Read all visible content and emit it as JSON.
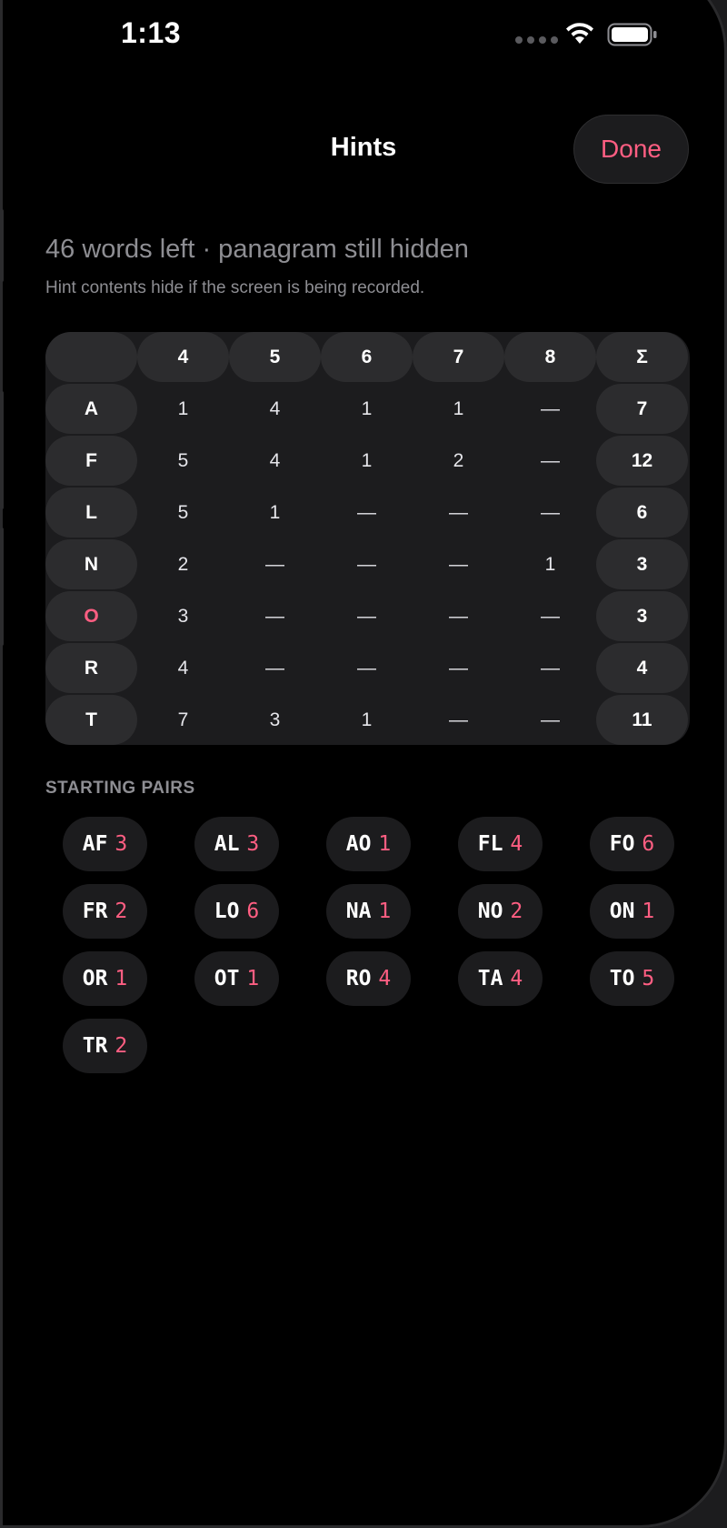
{
  "status_bar": {
    "time": "1:13"
  },
  "header": {
    "title": "Hints",
    "done_label": "Done"
  },
  "summary": "46 words left · panagram still hidden",
  "subnote": "Hint contents hide if the screen is being recorded.",
  "table": {
    "columns": [
      "4",
      "5",
      "6",
      "7",
      "8",
      "Σ"
    ],
    "rows": [
      {
        "letter": "A",
        "values": [
          "1",
          "4",
          "1",
          "1",
          "—"
        ],
        "total": "7"
      },
      {
        "letter": "F",
        "values": [
          "5",
          "4",
          "1",
          "2",
          "—"
        ],
        "total": "12"
      },
      {
        "letter": "L",
        "values": [
          "5",
          "1",
          "—",
          "—",
          "—"
        ],
        "total": "6"
      },
      {
        "letter": "N",
        "values": [
          "2",
          "—",
          "—",
          "—",
          "1"
        ],
        "total": "3"
      },
      {
        "letter": "O",
        "values": [
          "3",
          "—",
          "—",
          "—",
          "—"
        ],
        "total": "3",
        "accent": true
      },
      {
        "letter": "R",
        "values": [
          "4",
          "—",
          "—",
          "—",
          "—"
        ],
        "total": "4"
      },
      {
        "letter": "T",
        "values": [
          "7",
          "3",
          "1",
          "—",
          "—"
        ],
        "total": "11"
      }
    ]
  },
  "starting_pairs": {
    "label": "STARTING PAIRS",
    "items": [
      {
        "pair": "AF",
        "count": "3"
      },
      {
        "pair": "AL",
        "count": "3"
      },
      {
        "pair": "AO",
        "count": "1"
      },
      {
        "pair": "FL",
        "count": "4"
      },
      {
        "pair": "FO",
        "count": "6"
      },
      {
        "pair": "FR",
        "count": "2"
      },
      {
        "pair": "LO",
        "count": "6"
      },
      {
        "pair": "NA",
        "count": "1"
      },
      {
        "pair": "NO",
        "count": "2"
      },
      {
        "pair": "ON",
        "count": "1"
      },
      {
        "pair": "OR",
        "count": "1"
      },
      {
        "pair": "OT",
        "count": "1"
      },
      {
        "pair": "RO",
        "count": "4"
      },
      {
        "pair": "TA",
        "count": "4"
      },
      {
        "pair": "TO",
        "count": "5"
      },
      {
        "pair": "TR",
        "count": "2"
      }
    ]
  },
  "colors": {
    "accent": "#ff5e82",
    "background": "#000000",
    "surface": "#1c1c1e",
    "cell": "#2c2c2e",
    "muted": "#8e8e93"
  },
  "icons": [
    "signal-icon",
    "wifi-icon",
    "battery-icon"
  ]
}
